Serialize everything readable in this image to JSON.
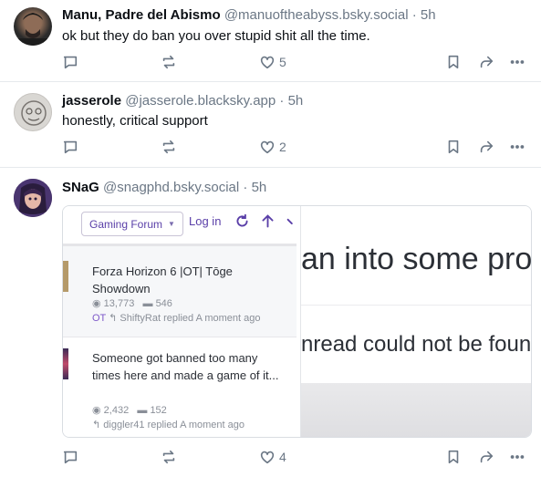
{
  "posts": [
    {
      "name": "Manu, Padre del Abismo",
      "handle": "@manuoftheabyss.bsky.social",
      "time": "· 5h",
      "text": "ok but they do ban you over stupid shit all the time.",
      "likes": "5",
      "avatar_colors": [
        "#2b2b2b",
        "#8a6a55"
      ]
    },
    {
      "name": "jasserole",
      "handle": "@jasserole.blacksky.app",
      "time": "· 5h",
      "text": "honestly, critical support",
      "likes": "2",
      "avatar_colors": [
        "#d6d4d0",
        "#6b6865"
      ]
    },
    {
      "name": "SNaG",
      "handle": "@snagphd.bsky.social",
      "time": "· 5h",
      "likes": "4",
      "avatar_colors": [
        "#3a2a55",
        "#c79a8a"
      ],
      "embed": {
        "forum_button": "Gaming Forum",
        "login": "Log in",
        "threads": [
          {
            "title": "Forza Horizon 6 |OT| Tōge Showdown",
            "views": "13,773",
            "replies": "546",
            "tag": "OT",
            "reply_line": "ShiftyRat replied A moment ago"
          },
          {
            "title": "Someone got banned too many times here and made a game of it...",
            "views": "2,432",
            "replies": "152",
            "tag": "",
            "reply_line": "diggler41 replied A moment ago"
          }
        ],
        "right_line1": "an into some pro",
        "right_line2": "nread could not be foun"
      }
    }
  ],
  "colors": {
    "text": "#0b0f14",
    "muted": "#6b7785",
    "forum_accent": "#5a3fa8"
  },
  "icons": [
    "reply-icon",
    "repost-icon",
    "like-icon",
    "bookmark-icon",
    "share-icon",
    "more-icon"
  ]
}
